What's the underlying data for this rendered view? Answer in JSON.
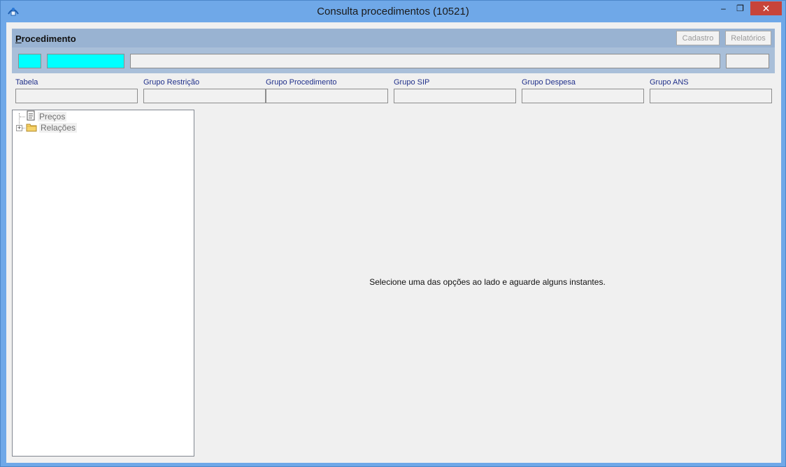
{
  "window": {
    "title": "Consulta procedimentos (10521)",
    "controls": {
      "minimize": "–",
      "maximize": "❐",
      "close": "✕"
    }
  },
  "header": {
    "title_first_letter": "P",
    "title_rest": "rocedimento",
    "buttons": {
      "cadastro": "Cadastro",
      "relatorios": "Relatórios"
    }
  },
  "groups": [
    {
      "label": "Tabela"
    },
    {
      "label": "Grupo Restrição"
    },
    {
      "label": "Grupo Procedimento"
    },
    {
      "label": "Grupo SIP"
    },
    {
      "label": "Grupo Despesa"
    },
    {
      "label": "Grupo ANS"
    }
  ],
  "tree": {
    "items": [
      {
        "label": "Preços",
        "icon": "document-icon"
      },
      {
        "label": "Relações",
        "icon": "folder-icon",
        "expander": "+"
      }
    ]
  },
  "main": {
    "message": "Selecione uma das opções ao lado e aguarde alguns instantes."
  },
  "colors": {
    "highlight_field": "#00ffff",
    "header_panel": "#99b3d2",
    "group_label": "#1f2f8a"
  }
}
